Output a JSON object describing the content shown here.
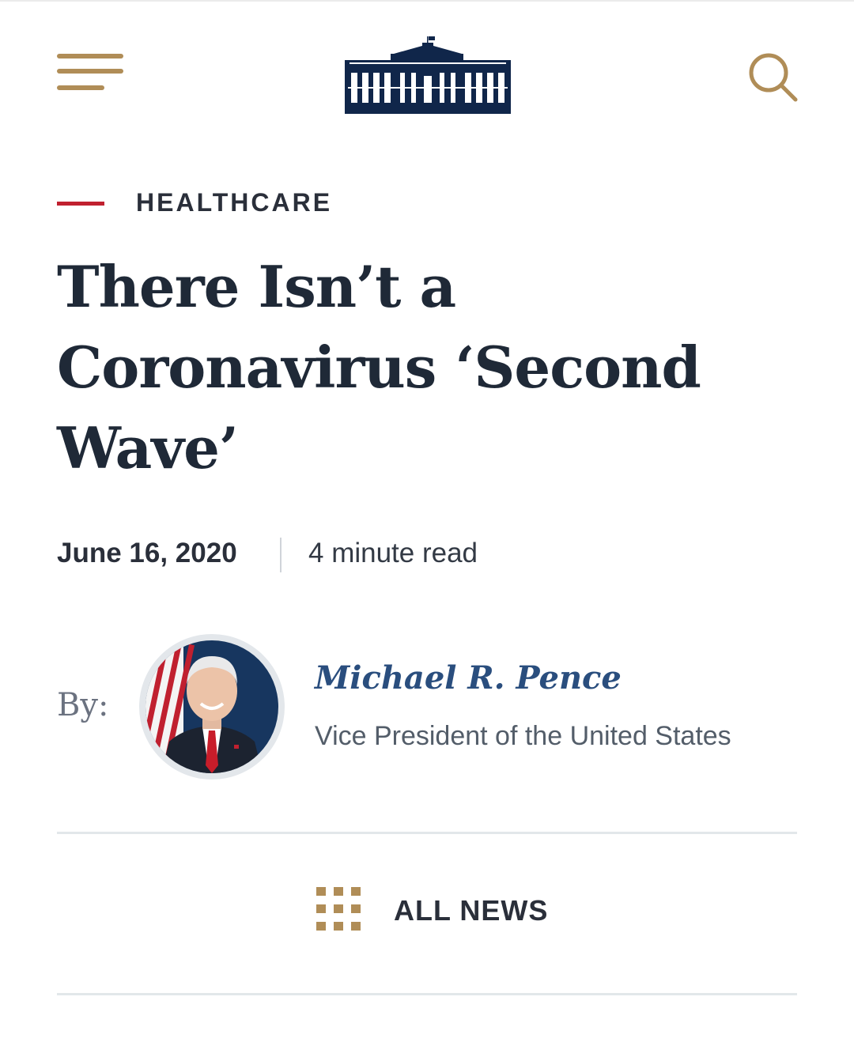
{
  "header": {
    "menu_icon": "hamburger-menu-icon",
    "logo_icon": "white-house-logo",
    "search_icon": "search-icon"
  },
  "article": {
    "category": "HEALTHCARE",
    "headline": "There Isn’t a Coronavirus ‘Second Wave’",
    "date": "June 16, 2020",
    "read_time": "4 minute read"
  },
  "byline": {
    "label": "By:",
    "author_name": "Michael R. Pence",
    "author_title": "Vice President of the United States",
    "avatar_icon": "author-portrait"
  },
  "footer_nav": {
    "all_news_label": "ALL NEWS",
    "all_news_icon": "grid-icon"
  },
  "colors": {
    "accent_gold": "#b08d57",
    "category_red": "#c0202f",
    "navy": "#10264a",
    "author_link": "#2a4e7e",
    "text_dark": "#1f2937"
  }
}
